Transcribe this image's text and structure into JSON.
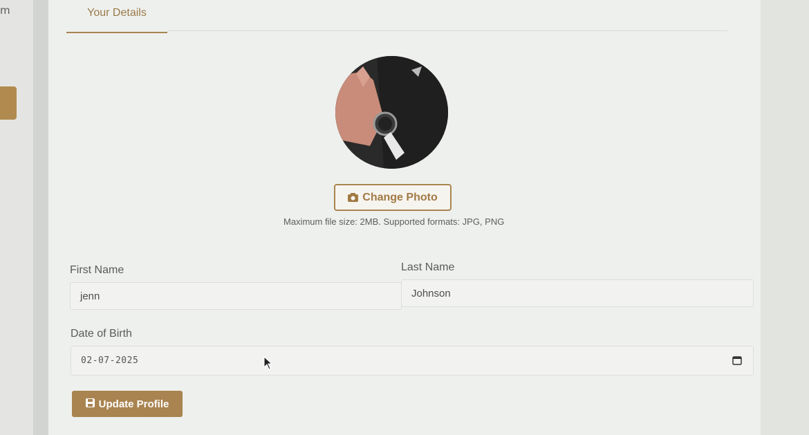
{
  "sidebar": {
    "partial_text": "m"
  },
  "tabs": {
    "active_label": "Your Details"
  },
  "profile": {
    "change_photo_label": "Change Photo",
    "help_text": "Maximum file size: 2MB. Supported formats: JPG, PNG"
  },
  "form": {
    "first_name": {
      "label": "First Name",
      "value": "jenn"
    },
    "last_name": {
      "label": "Last Name",
      "value": "Johnson"
    },
    "dob": {
      "label": "Date of Birth",
      "value": "02-07-2025"
    }
  },
  "actions": {
    "update_label": "Update Profile"
  },
  "theme": {
    "accent": "#a98450",
    "card_bg": "#eef0ed"
  },
  "icons": [
    "camera-icon",
    "calendar-icon",
    "save-icon",
    "mouse-cursor-icon"
  ]
}
